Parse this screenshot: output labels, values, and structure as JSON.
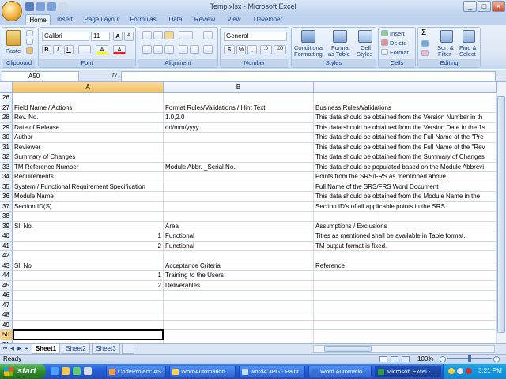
{
  "window": {
    "title": "Temp.xlsx - Microsoft Excel",
    "minimize": "_",
    "maximize": "□",
    "close": "✕"
  },
  "tabs": [
    "Home",
    "Insert",
    "Page Layout",
    "Formulas",
    "Data",
    "Review",
    "View",
    "Developer"
  ],
  "ribbon": {
    "clipboard": {
      "label": "Clipboard",
      "paste": "Paste"
    },
    "font": {
      "label": "Font",
      "name": "Calibri",
      "size": "11",
      "grow": "A",
      "shrink": "A",
      "bold": "B",
      "italic": "I",
      "underline": "U",
      "fill": "A",
      "color": "A"
    },
    "alignment": {
      "label": "Alignment"
    },
    "number": {
      "label": "Number",
      "format": "General",
      "currency": "$",
      "percent": "%",
      "comma": ",",
      "inc": ".0",
      "dec": ".00"
    },
    "styles": {
      "label": "Styles",
      "conditional1": "Conditional",
      "conditional2": "Formatting",
      "table1": "Format",
      "table2": "as Table",
      "cell1": "Cell",
      "cell2": "Styles"
    },
    "cells": {
      "label": "Cells",
      "insert": "Insert",
      "delete": "Delete",
      "format": "Format"
    },
    "editing": {
      "label": "Editing",
      "sigma": "Σ",
      "sort1": "Sort &",
      "sort2": "Filter",
      "find1": "Find &",
      "find2": "Select"
    }
  },
  "formula_bar": {
    "name_box": "A50",
    "fx": "fx",
    "value": ""
  },
  "columns": [
    "A",
    "B"
  ],
  "rows": [
    {
      "num": "26",
      "a": "",
      "b": "",
      "c": ""
    },
    {
      "num": "27",
      "a": "Field Name / Actions",
      "b": "Format  Rules/Validations / Hint Text",
      "c": "Business Rules/Validations"
    },
    {
      "num": "28",
      "a": "Rev. No.",
      "b": "1.0,2.0",
      "c": "This data should be obtained from the Version Number in th"
    },
    {
      "num": "29",
      "a": "Date of Release",
      "b": "dd/mm/yyyy",
      "c": "This data should be obtained from the Version Date in the 1s"
    },
    {
      "num": "30",
      "a": "Author",
      "b": "",
      "c": "This data should be obtained from the Full Name of the \"Pre"
    },
    {
      "num": "31",
      "a": "Reviewer",
      "b": "",
      "c": "This data should be obtained from the Full Name of the \"Rev"
    },
    {
      "num": "32",
      "a": "Summary of Changes",
      "b": "",
      "c": "This data should be obtained from the Summary of Changes"
    },
    {
      "num": "33",
      "a": "TM Reference Number",
      "b": "Module Abbr. _Serial No.",
      "c": "This data should be populated based on the Module Abbrevi"
    },
    {
      "num": "34",
      "a": "Requirements",
      "b": "",
      "c": "Points from the SRS/FRS as mentioned above."
    },
    {
      "num": "35",
      "a": "System / Functional Requirement Specification",
      "b": "",
      "c": "Full Name of the SRS/FRS Word Document"
    },
    {
      "num": "36",
      "a": "Module Name",
      "b": "",
      "c": "This data should be obtained from the Module Name in the"
    },
    {
      "num": "37",
      "a": "Section ID(S)",
      "b": "",
      "c": "Section ID's of all applicable points in the SRS"
    },
    {
      "num": "38",
      "a": "",
      "b": "",
      "c": ""
    },
    {
      "num": "39",
      "a": "Sl. No.",
      "b": "Area",
      "c": "Assumptions / Exclusions"
    },
    {
      "num": "40",
      "a_num": "1",
      "b": "Functional",
      "c": "Titles as mentioned shall be available in Table format."
    },
    {
      "num": "41",
      "a_num": "2",
      "b": "Functional",
      "c": "TM output format is fixed."
    },
    {
      "num": "42",
      "a": "",
      "b": "",
      "c": ""
    },
    {
      "num": "43",
      "a": "Sl. No",
      "b": "Acceptance Criteria",
      "c": "Reference"
    },
    {
      "num": "44",
      "a_num": "1",
      "b": "Training to the Users",
      "c": ""
    },
    {
      "num": "45",
      "a_num": "2",
      "b": "Deliverables",
      "c": ""
    },
    {
      "num": "46",
      "a": "",
      "b": "",
      "c": ""
    },
    {
      "num": "47",
      "a": "",
      "b": "",
      "c": ""
    },
    {
      "num": "48",
      "a": "",
      "b": "",
      "c": ""
    },
    {
      "num": "49",
      "a": "",
      "b": "",
      "c": ""
    },
    {
      "num": "50",
      "a": "",
      "b": "",
      "c": ""
    },
    {
      "num": "51",
      "a": "",
      "b": "",
      "c": ""
    }
  ],
  "sheets": [
    "Sheet1",
    "Sheet2",
    "Sheet3"
  ],
  "status": {
    "left": "Ready",
    "zoom": "100%"
  },
  "taskbar": {
    "start": "start",
    "items": [
      "CodeProject: AS...",
      "WordAutomation....",
      "word4.JPG - Paint",
      "Word Automatio...",
      "Microsoft Excel - ..."
    ],
    "clock": "3:21 PM"
  }
}
